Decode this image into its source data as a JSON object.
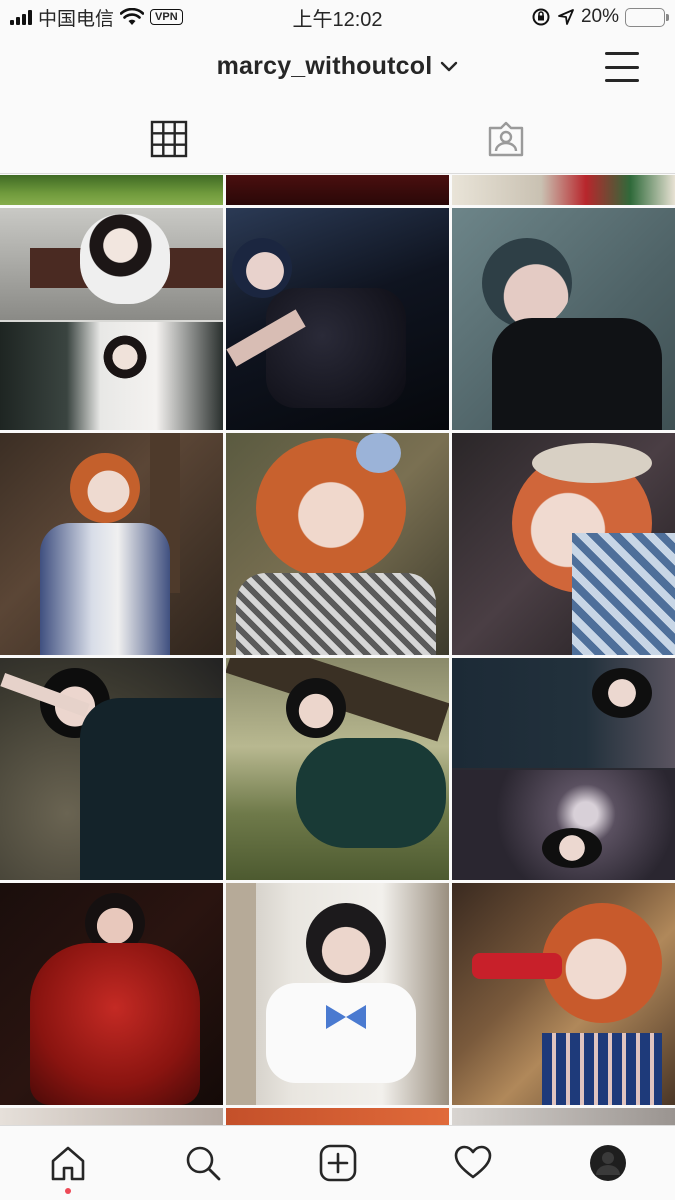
{
  "status_bar": {
    "carrier": "中国电信",
    "vpn": "VPN",
    "time": "上午12:02",
    "battery": "20%",
    "battery_level": 0.2
  },
  "header": {
    "username": "marcy_withoutcol"
  },
  "tabs": [
    {
      "icon": "grid-icon",
      "active": true
    },
    {
      "icon": "tagged-icon",
      "active": false
    }
  ],
  "grid": {
    "rows": [
      [
        {
          "tone": "green-foliage"
        },
        {
          "tone": "dark-red"
        },
        {
          "tone": "light-knit-roses"
        }
      ],
      [
        {
          "tone": "white-dress-balcony-collage"
        },
        {
          "tone": "navy-dress-dark-sofa"
        },
        {
          "tone": "grey-teal-blue-hair-portrait"
        }
      ],
      [
        {
          "tone": "orange-hair-plaid-forest"
        },
        {
          "tone": "orange-hair-flower-crown"
        },
        {
          "tone": "orange-hair-tears-closeup"
        }
      ],
      [
        {
          "tone": "sailor-uniform-lying-petals"
        },
        {
          "tone": "sailor-uniform-crouching-tree"
        },
        {
          "tone": "sailor-uniform-collage"
        }
      ],
      [
        {
          "tone": "red-tulle-dress"
        },
        {
          "tone": "white-sailor-blue-bow"
        },
        {
          "tone": "orange-curls-red-gun"
        }
      ]
    ]
  },
  "bottom_nav": [
    {
      "icon": "home-icon",
      "active": true
    },
    {
      "icon": "search-icon",
      "active": false
    },
    {
      "icon": "add-post-icon",
      "active": false
    },
    {
      "icon": "heart-icon",
      "active": false
    },
    {
      "icon": "profile-icon",
      "active": false
    }
  ],
  "colors": {
    "text": "#262626",
    "divider": "#dbdbdb",
    "background": "#fafafa",
    "notification_dot": "#ed4956",
    "battery_fill": "#f5c518"
  }
}
